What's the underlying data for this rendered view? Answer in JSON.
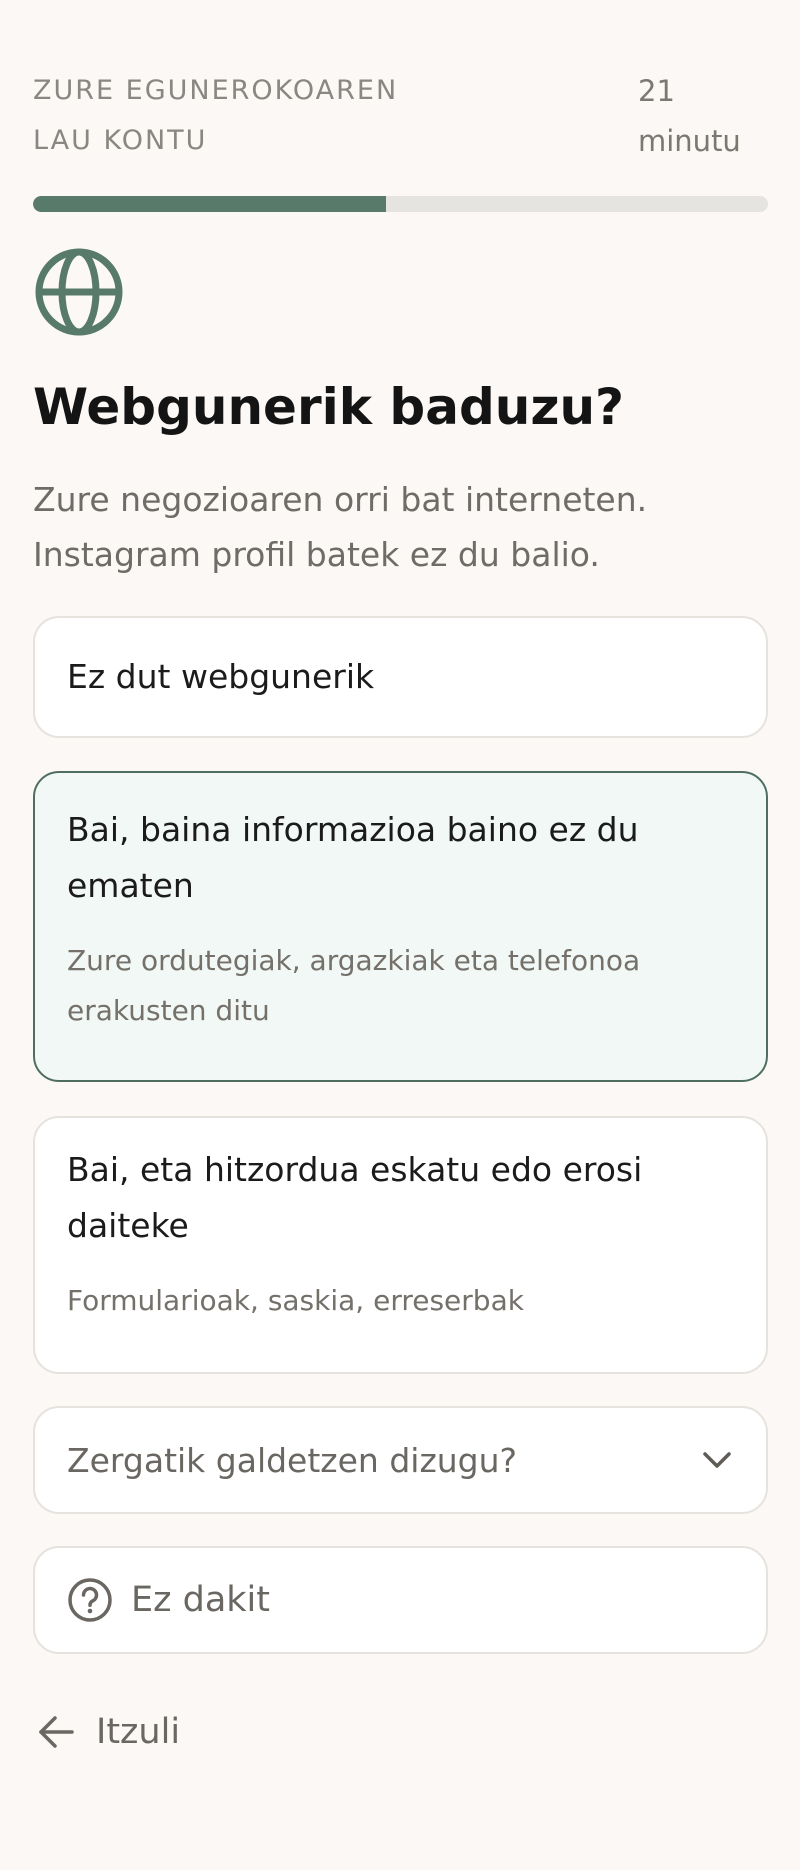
{
  "header": {
    "title": "ZURE EGUNEROKOAREN LAU KONTU",
    "time": "21 minutu"
  },
  "progress": {
    "fraction": 0.48,
    "color": "#577a6b"
  },
  "icon": "globe-icon",
  "question": {
    "title": "Webgunerik baduzu?",
    "subtitle": "Zure negozioaren orri bat interneten. Instagram profil batek ez du balio."
  },
  "options": [
    {
      "label": "Ez dut webgunerik",
      "desc": "",
      "selected": false
    },
    {
      "label": "Bai, baina informazioa baino ez du ematen",
      "desc": "Zure ordutegiak, argazkiak eta telefonoa erakusten ditu",
      "selected": true
    },
    {
      "label": "Bai, eta hitzordua eskatu edo erosi daiteke",
      "desc": "Formularioak, saskia, erreserbak",
      "selected": false
    }
  ],
  "why": {
    "label": "Zergatik galdetzen dizugu?",
    "icon": "chevron-down-icon"
  },
  "dont_know": {
    "label": "Ez dakit",
    "icon": "question-circle-icon"
  },
  "back": {
    "label": "Itzuli",
    "icon": "arrow-left-icon"
  },
  "colors": {
    "accent": "#577a6b",
    "selected_bg": "#f2f8f6",
    "background": "#fbf8f5"
  }
}
